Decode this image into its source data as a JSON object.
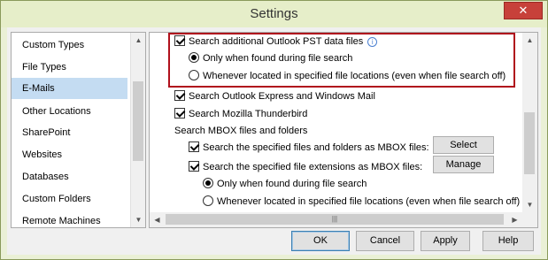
{
  "window": {
    "title": "Settings",
    "close_symbol": "✕"
  },
  "left_list": {
    "items": [
      {
        "label": "Custom Types",
        "selected": false
      },
      {
        "label": "File Types",
        "selected": false
      },
      {
        "label": "E-Mails",
        "selected": true
      },
      {
        "label": "Other Locations",
        "selected": false
      },
      {
        "label": "SharePoint",
        "selected": false
      },
      {
        "label": "Websites",
        "selected": false
      },
      {
        "label": "Databases",
        "selected": false
      },
      {
        "label": "Custom Folders",
        "selected": false
      },
      {
        "label": "Remote Machines",
        "selected": false
      }
    ]
  },
  "right": {
    "pst_checkbox": "Search additional Outlook PST data files",
    "pst_only_found": "Only when found during file search",
    "pst_whenever": "Whenever located in specified file locations (even when file search off)",
    "outlook_express": "Search Outlook Express and Windows Mail",
    "thunderbird": "Search Mozilla Thunderbird",
    "mbox_header": "Search MBOX files and folders",
    "mbox_files_folders": "Search the specified files and folders as MBOX files:",
    "mbox_select_button": "Select",
    "mbox_extensions": "Search the specified file extensions as MBOX files:",
    "mbox_manage_button": "Manage",
    "mbox_only_found": "Only when found during file search",
    "mbox_whenever": "Whenever located in specified file locations (even when file search off)"
  },
  "footer": {
    "ok": "OK",
    "cancel": "Cancel",
    "apply": "Apply",
    "help": "Help"
  },
  "icons": {
    "info": "i",
    "up_arrow": "▲",
    "down_arrow": "▼",
    "left_arrow": "◀",
    "right_arrow": "▶",
    "grip": "|||"
  }
}
